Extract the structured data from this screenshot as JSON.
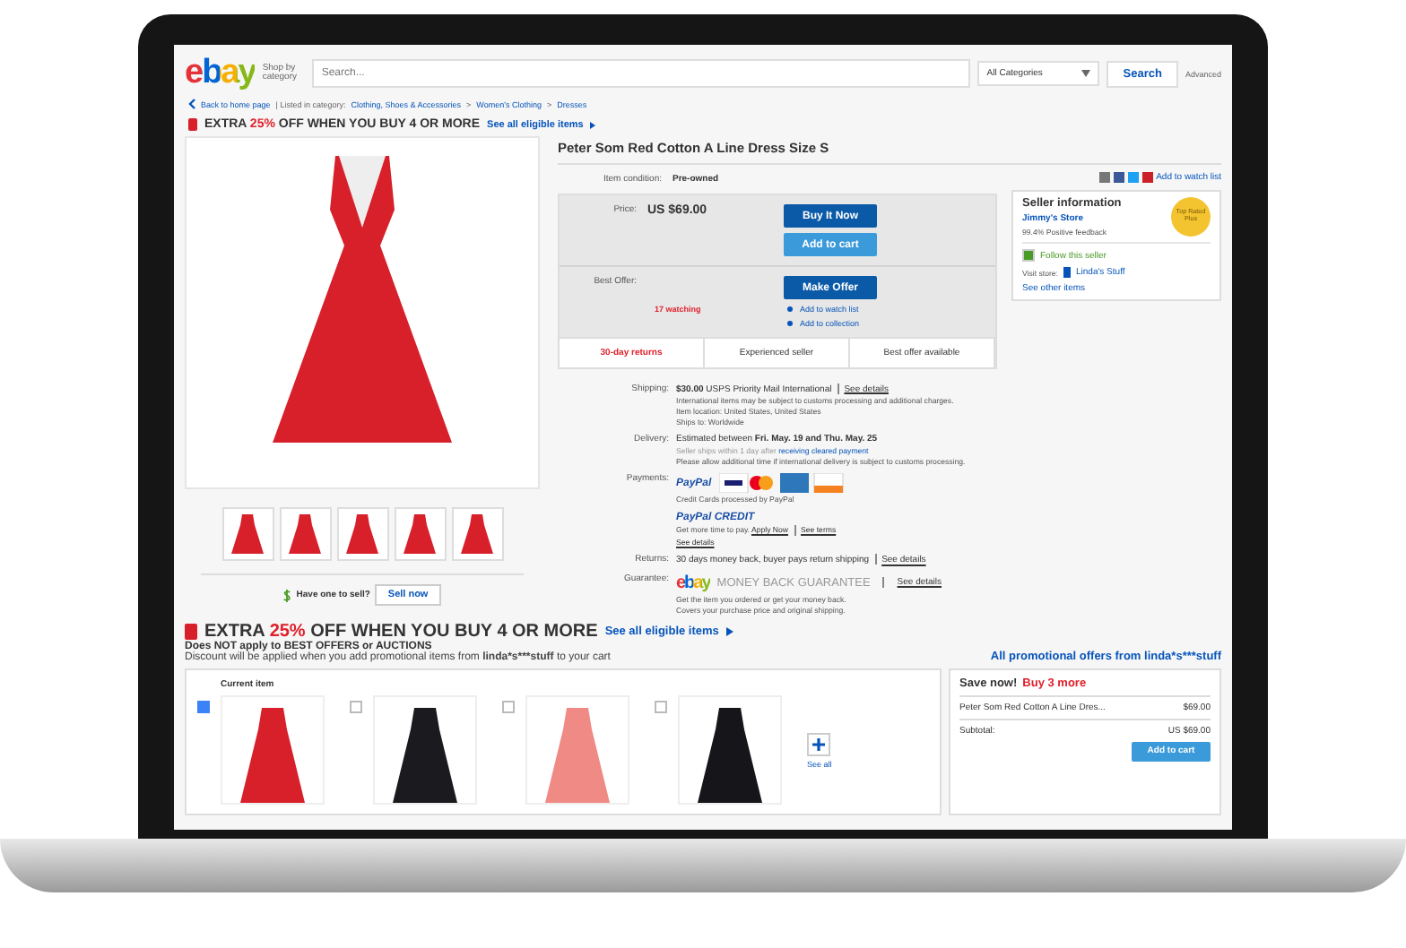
{
  "header": {
    "logo": "ebay",
    "shop_by": "Shop by category",
    "search": {
      "placeholder": "Search..."
    },
    "category": "All Categories",
    "search_button": "Search",
    "advanced": "Advanced"
  },
  "breadcrumb": {
    "back": "Back to home page",
    "listed_in": "| Listed in category:",
    "separator": ">",
    "crumbs": [
      "Clothing, Shoes & Accessories",
      "Women's Clothing",
      "Dresses"
    ]
  },
  "promo": {
    "lead": "EXTRA",
    "highlight": "25%",
    "rest": "OFF WHEN YOU BUY 4 OR MORE",
    "link": "See all eligible items"
  },
  "title": "Peter Som Red Cotton A Line Dress Size S",
  "condition": {
    "label": "Item condition:",
    "value": "Pre-owned"
  },
  "watch_link": "Add to watch list",
  "price": {
    "label": "Price:",
    "value": "US $69.00",
    "buy_now": "Buy It Now",
    "add_to_cart": "Add to cart"
  },
  "offer": {
    "label": "Best Offer:",
    "button": "Make Offer",
    "watching": "17 watching",
    "links": [
      "Add to watch list",
      "Add to collection"
    ]
  },
  "features": [
    {
      "text": "30-day returns",
      "emphasis": true
    },
    {
      "text": "Experienced seller",
      "emphasis": false
    },
    {
      "text": "Best offer available",
      "emphasis": false
    }
  ],
  "seller": {
    "heading": "Seller information",
    "name": "Jimmy's Store",
    "feedback": "99.4% Positive feedback",
    "badge": "Top Rated Plus",
    "follow": "Follow this seller",
    "visit": "Visit store:",
    "store": "Linda's Stuff",
    "other": "See other items"
  },
  "details": [
    {
      "kind": "shipping",
      "label": "Shipping:",
      "main": "**$30.00** USPS Priority Mail International",
      "link": "See details",
      "lines": [
        "International items may be subject to customs processing and additional charges.",
        "Item location: United States, United States",
        "Ships to: Worldwide"
      ]
    },
    {
      "kind": "delivery",
      "label": "Delivery:",
      "main": "Estimated between **Fri. May. 19 and Thu. May. 25**",
      "note": "Seller ships within 1 day after",
      "note_link": "receiving cleared payment",
      "lines": [
        "Please allow additional time if international delivery is subject to customs processing."
      ]
    },
    {
      "kind": "payments",
      "label": "Payments:",
      "paypal": "PayPal",
      "cards_note": "Credit Cards processed by PayPal",
      "credit_logo": "PayPal CREDIT",
      "credit_text": "Get more time to pay.",
      "apply": "Apply Now",
      "terms": "See terms",
      "link": "See details"
    },
    {
      "kind": "returns",
      "label": "Returns:",
      "main": "30 days money back, buyer pays return shipping",
      "link": "See details"
    },
    {
      "kind": "guarantee",
      "label": "Guarantee:",
      "logo": "ebay",
      "guarantee": "MONEY BACK GUARANTEE",
      "link": "See details",
      "lines": [
        "Get the item you ordered or get your money back.",
        "Covers your purchase price and original shipping."
      ]
    }
  ],
  "sell": {
    "question": "Have one to sell?",
    "button": "Sell now"
  },
  "bundle": {
    "lead": "EXTRA",
    "highlight": "25%",
    "rest": "OFF WHEN YOU BUY 4 OR MORE",
    "link": "See all eligible items",
    "exclusion": "Does NOT apply to BEST OFFERS or AUCTIONS",
    "discount_before": "Discount will be applied when you add promotional items from",
    "discount_seller": "linda*s***stuff",
    "discount_after": "to your cart",
    "all_offers": "All promotional offers from linda*s***stuff",
    "items": [
      {
        "label": "Current item",
        "checked": true
      },
      {
        "checked": false
      },
      {
        "checked": false
      },
      {
        "checked": false
      }
    ],
    "see_all": "See all",
    "cart": {
      "save": "Save now!",
      "more": "Buy 3 more",
      "item": "Peter Som Red Cotton A Line Dres...",
      "item_price": "$69.00",
      "subtotal_label": "Subtotal:",
      "subtotal": "US $69.00",
      "button": "Add to cart"
    }
  }
}
